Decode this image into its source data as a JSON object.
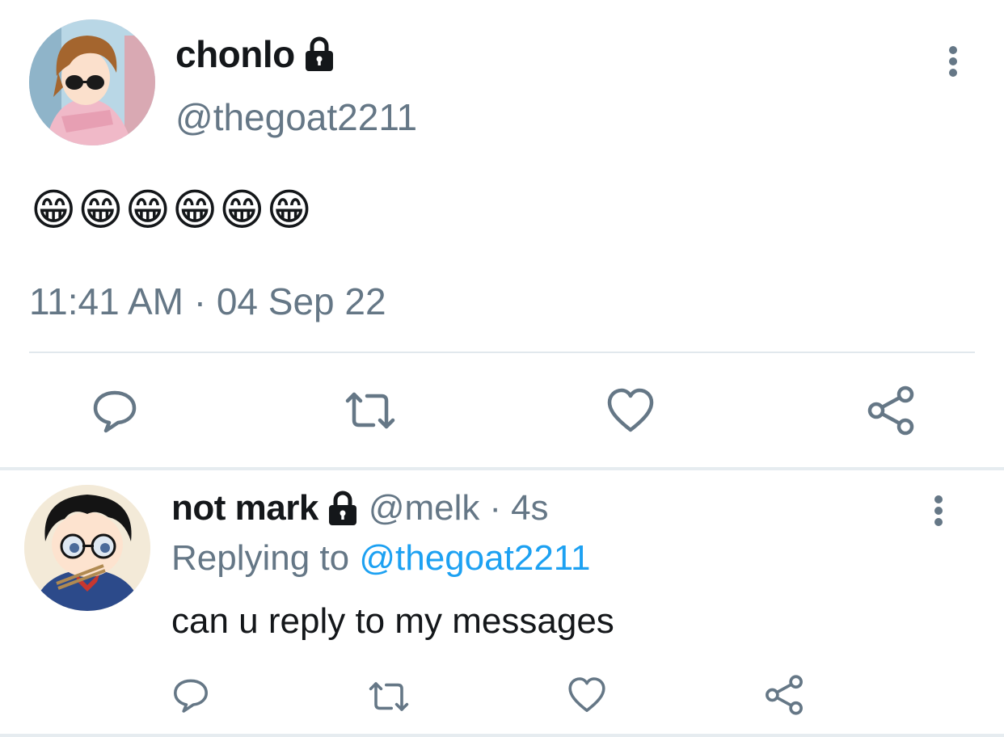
{
  "main_tweet": {
    "display_name": "chonlo",
    "handle": "@thegoat2211",
    "body": "😁😁😁😁😁😁",
    "timestamp": "11:41 AM · 04 Sep 22",
    "protected_icon": "lock-icon",
    "actions": [
      "reply-icon",
      "retweet-icon",
      "like-icon",
      "share-icon"
    ]
  },
  "reply_tweet": {
    "display_name": "not mark",
    "handle": "@melk",
    "separator": "·",
    "age": "4s",
    "replying_prefix": "Replying to",
    "replying_to": "@thegoat2211",
    "body": "can u reply to my messages",
    "protected_icon": "lock-icon",
    "actions": [
      "reply-icon",
      "retweet-icon",
      "like-icon",
      "share-icon"
    ]
  },
  "colors": {
    "text": "#14171a",
    "muted": "#657786",
    "link": "#1da1f2",
    "divider": "#e1e8ed"
  }
}
